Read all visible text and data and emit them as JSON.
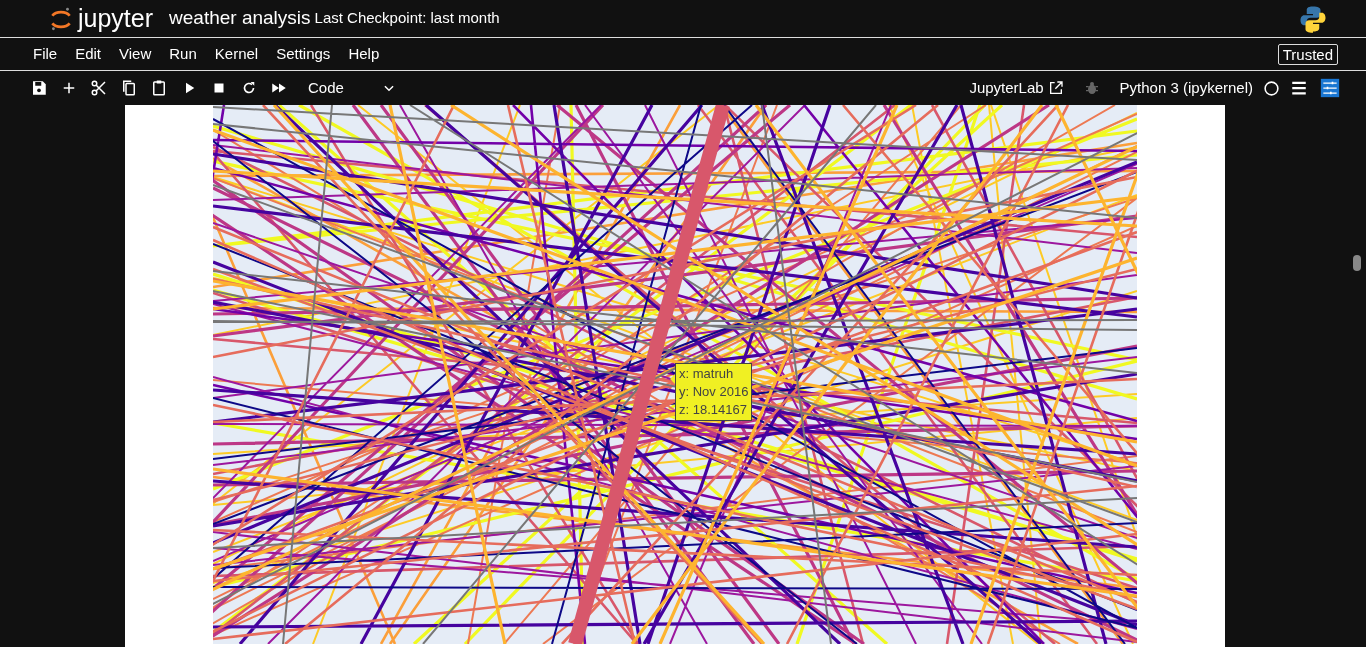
{
  "header": {
    "logo_text": "jupyter",
    "notebook_title": "weather analysis",
    "checkpoint": "Last Checkpoint: last month"
  },
  "menu": [
    "File",
    "Edit",
    "View",
    "Run",
    "Kernel",
    "Settings",
    "Help"
  ],
  "trusted": "Trusted",
  "toolbar": {
    "cell_type": "Code",
    "open_in": "JupyterLab",
    "kernel_name": "Python 3 (ipykernel)",
    "kernel_busy": false
  },
  "plot": {
    "tooltip": [
      "x: matruh",
      "y: Nov 2016",
      "z: 18.14167"
    ]
  }
}
